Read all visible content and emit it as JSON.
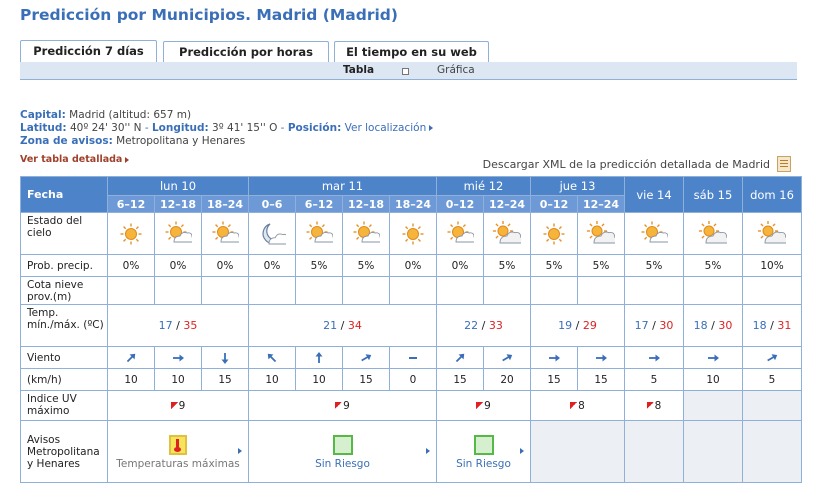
{
  "page_title": "Predicción por Municipios. Madrid (Madrid)",
  "tabs": [
    {
      "label": "Predicción 7 días",
      "active": true
    },
    {
      "label": "Predicción por horas",
      "active": false
    },
    {
      "label": "El tiempo en su web",
      "active": false
    }
  ],
  "subtabs": {
    "tabla": "Tabla",
    "grafica": "Gráfica"
  },
  "info": {
    "capital_label": "Capital:",
    "capital_value": "Madrid (altitud: 657 m)",
    "latitud_label": "Latitud:",
    "latitud_value": "40º 24' 30'' N",
    "longitud_label": "Longitud:",
    "longitud_value": "3º 41' 15'' O",
    "posicion_label": "Posición:",
    "posicion_link": "Ver localización",
    "zona_label": "Zona de avisos:",
    "zona_value": "Metropolitana y Henares"
  },
  "ver_tabla_detallada": "Ver tabla detallada",
  "xml_link": "Descargar XML de la predicción detallada de Madrid",
  "table": {
    "fecha_label": "Fecha",
    "row_labels": {
      "estado": "Estado del cielo",
      "prob": "Prob. precip.",
      "cota": "Cota nieve prov.(m)",
      "temp": "Temp. mín./máx. (ºC)",
      "viento": "Viento",
      "kmh": "(km/h)",
      "uv": "Indice UV máximo",
      "avisos": "Avisos Metropolitana y Henares"
    },
    "days": [
      {
        "label": "lun 10",
        "intervals": [
          "6–12",
          "12–18",
          "18–24"
        ],
        "temp_min": "17",
        "temp_max": "35",
        "uv": "9",
        "aviso_type": "temp",
        "aviso": "Temperaturas máximas"
      },
      {
        "label": "mar 11",
        "intervals": [
          "0–6",
          "6–12",
          "12–18",
          "18–24"
        ],
        "temp_min": "21",
        "temp_max": "34",
        "uv": "9",
        "aviso_type": "none",
        "aviso": "Sin Riesgo"
      },
      {
        "label": "mié 12",
        "intervals": [
          "0–12",
          "12–24"
        ],
        "temp_min": "22",
        "temp_max": "33",
        "uv": "9",
        "aviso_type": "none",
        "aviso": "Sin Riesgo"
      },
      {
        "label": "jue 13",
        "intervals": [
          "0–12",
          "12–24"
        ],
        "temp_min": "19",
        "temp_max": "29",
        "uv": "8",
        "aviso_type": "empty",
        "aviso": ""
      },
      {
        "label": "vie 14",
        "intervals": [],
        "temp_min": "17",
        "temp_max": "30",
        "uv": "8",
        "aviso_type": "empty",
        "aviso": ""
      },
      {
        "label": "sáb 15",
        "intervals": [],
        "temp_min": "18",
        "temp_max": "30",
        "uv": "",
        "aviso_type": "empty",
        "aviso": ""
      },
      {
        "label": "dom 16",
        "intervals": [],
        "temp_min": "18",
        "temp_max": "31",
        "uv": "",
        "aviso_type": "empty",
        "aviso": ""
      }
    ],
    "columns": [
      {
        "sky": "sun",
        "prob": "0%",
        "wind_deg": 45,
        "wind_speed": "10"
      },
      {
        "sky": "sun-cloud",
        "prob": "0%",
        "wind_deg": 90,
        "wind_speed": "10"
      },
      {
        "sky": "sun-cloud",
        "prob": "0%",
        "wind_deg": 180,
        "wind_speed": "15"
      },
      {
        "sky": "moon-cloud",
        "prob": "0%",
        "wind_deg": 315,
        "wind_speed": "10"
      },
      {
        "sky": "sun-cloud",
        "prob": "5%",
        "wind_deg": 0,
        "wind_speed": "10"
      },
      {
        "sky": "sun-cloud",
        "prob": "5%",
        "wind_deg": 60,
        "wind_speed": "15"
      },
      {
        "sky": "sun",
        "prob": "0%",
        "wind_deg": -1,
        "wind_speed": "0"
      },
      {
        "sky": "sun-cloud",
        "prob": "0%",
        "wind_deg": 45,
        "wind_speed": "15"
      },
      {
        "sky": "sun-clouds",
        "prob": "5%",
        "wind_deg": 60,
        "wind_speed": "20"
      },
      {
        "sky": "sun",
        "prob": "5%",
        "wind_deg": 90,
        "wind_speed": "15"
      },
      {
        "sky": "sun-clouds",
        "prob": "5%",
        "wind_deg": 90,
        "wind_speed": "15"
      },
      {
        "sky": "sun-cloud",
        "prob": "5%",
        "wind_deg": 90,
        "wind_speed": "5"
      },
      {
        "sky": "sun-clouds",
        "prob": "5%",
        "wind_deg": 90,
        "wind_speed": "10"
      },
      {
        "sky": "sun-clouds",
        "prob": "10%",
        "wind_deg": 60,
        "wind_speed": "5"
      }
    ]
  }
}
